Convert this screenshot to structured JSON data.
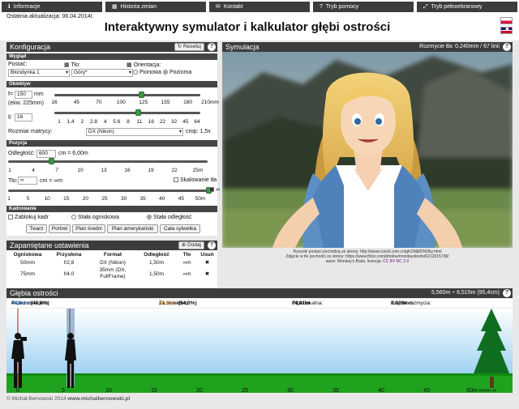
{
  "nav": [
    {
      "icon": "ℹ",
      "label": "Informacje"
    },
    {
      "icon": "▦",
      "label": "Historia zmian"
    },
    {
      "icon": "✉",
      "label": "Kontakt"
    },
    {
      "icon": "?",
      "label": "Tryb pomocy"
    },
    {
      "icon": "⤢",
      "label": "Tryb pełnoekranowy"
    }
  ],
  "header": {
    "last_update": "Ostatnia aktualizacja: 06.04.2014r.",
    "title": "Interaktywny symulator i kalkulator głębi ostrości"
  },
  "config": {
    "title": "Konfiguracja",
    "reset": "Resetuj",
    "help": "?",
    "wyglad": {
      "section": "Wygląd",
      "postac_label": "Postać:",
      "postac_value": "Blondynka 1",
      "tlo_label": "Tło:",
      "tlo_value": "Góry*",
      "orient_label": "Orientacja:",
      "orient_opt1": "Pionowa",
      "orient_opt2": "Pozioma",
      "orientation_selected": "Pozioma"
    },
    "obiektyw": {
      "section": "Obiektyw",
      "f_label": "f=",
      "f_value": "150",
      "f_unit": "mm",
      "ekw": "(ekw. 225mm)",
      "focal_ticks": [
        "16",
        "45",
        "70",
        "100",
        "125",
        "155",
        "180",
        "210mm"
      ],
      "focal_level": 0.6,
      "aperture_label": "f/",
      "aperture_value": "16",
      "aperture_ticks": [
        "1",
        "1.4",
        "2",
        "2.8",
        "4",
        "5.6",
        "8",
        "11",
        "16",
        "22",
        "32",
        "45",
        "64"
      ],
      "aperture_level": 0.58,
      "matrix_label": "Rozmiar matrycy:",
      "matrix_value": "DX (Nikon)",
      "crop": "crop: 1,5x"
    },
    "pozycja": {
      "section": "Pozycja",
      "dist_label": "Odległość:",
      "dist_value": "600",
      "dist_text": "cm = 6,00m",
      "dist_ticks": [
        "1",
        "4",
        "7",
        "10",
        "13",
        "16",
        "19",
        "22",
        "25m"
      ],
      "dist_level": 0.22,
      "bg_label": "Tło:",
      "bg_value": "∞",
      "bg_text": "cm = ∞m",
      "scale_bg": "Skalowanie tła",
      "bg_ticks": [
        "1",
        "5",
        "10",
        "15",
        "20",
        "25",
        "30",
        "35",
        "40",
        "45",
        "50m"
      ],
      "bg_level": 1.0,
      "inf_mark": "∞"
    },
    "kadrowanie": {
      "section": "Kadrowanie",
      "lock": "Zablokuj kadr",
      "mode1": "Stała ogniskowa",
      "mode2": "Stała odległość",
      "mode_selected": "Stała odległość",
      "buttons": [
        "Twarz",
        "Portret",
        "Plan średni",
        "Plan amerykański",
        "Cała sylwetka"
      ]
    }
  },
  "saved": {
    "title": "Zapamiętane ustawienia",
    "add": "Dodaj",
    "columns": [
      "Ogniskowa",
      "Przysłona",
      "Format",
      "Odległość",
      "Tło",
      "Usuń"
    ],
    "rows": [
      [
        "50mm",
        "f/2,8",
        "DX (Nikon)",
        "1,50m",
        "∞m",
        "✖"
      ],
      [
        "75mm",
        "f/4,0",
        "35mm (DX, FullFrame)",
        "1,50m",
        "∞m",
        "✖"
      ]
    ]
  },
  "simulation": {
    "title": "Symulacja",
    "blur_info": "Rozmycie tła: 0,240mm / 67 linii",
    "credit1": "Rysunki postaci pochodzą ze strony: http://www.coocil.com.cn/gfx2MjM2NDky.html",
    "credit2": "Zdjęcie w tle pochodzi ze strony: https://www.flickr.com/photos/mondaysbods/6212915738/",
    "credit3": "autor: Monday's Bods, licencja:",
    "credit_license": "CC BY-NC 2.0"
  },
  "dof": {
    "title": "Głębia ostrości",
    "range": "5,560m ÷ 6,515m (95,4cm)",
    "before_label": "Przed obiektem:",
    "before_value": "44,0cm",
    "before_pct": "(46,0%)",
    "after_label": "Za obiektem:",
    "after_value": "51,5cm",
    "after_pct": "(54,0%)",
    "hyper_label": "Hiperfokalna:",
    "hyper_value": "74,01m",
    "coc_label": "Krążek rozmycia:",
    "coc_value": "0.019mm",
    "ruler": [
      "0",
      "5",
      "10",
      "15",
      "20",
      "25",
      "30",
      "35",
      "40",
      "45",
      "50m"
    ],
    "ruler_tail": "∞∞∞ ∞",
    "colors": {
      "before": "#1a6fc8",
      "after": "#e07800"
    }
  },
  "footer": {
    "copyright": "© Michał Bernowski 2014",
    "site": "www.michalbernowski.pl"
  }
}
